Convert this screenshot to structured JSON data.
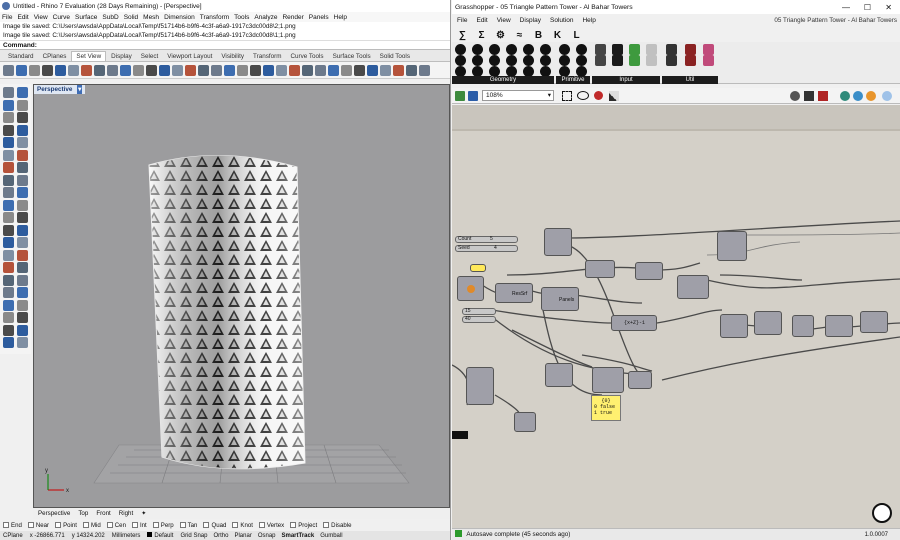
{
  "rhino": {
    "title": "Untitled - Rhino 7 Evaluation (28 Days Remaining) - [Perspective]",
    "menu": [
      "File",
      "Edit",
      "View",
      "Curve",
      "Surface",
      "SubD",
      "Solid",
      "Mesh",
      "Dimension",
      "Transform",
      "Tools",
      "Analyze",
      "Render",
      "Panels",
      "Help"
    ],
    "command_history": [
      "Image tile saved: C:\\Users\\awsda\\AppData\\Local\\Temp\\f51714b6-b9f6-4c3f-a6a9-1917c3dc00d8\\2;1.png",
      "Image tile saved: C:\\Users\\awsda\\AppData\\Local\\Temp\\f51714b6-b9f6-4c3f-a6a9-1917c3dc00d8\\1;1.png"
    ],
    "command_prompt": "Command:",
    "toolbar_tabs": [
      "Standard",
      "CPlanes",
      "Set View",
      "Display",
      "Select",
      "Viewport Layout",
      "Visibility",
      "Transform",
      "Curve Tools",
      "Surface Tools",
      "Solid Tools"
    ],
    "active_toolbar_tab": "Set View",
    "viewport_label": "Perspective",
    "viewport_tabs": [
      "Perspective",
      "Top",
      "Front",
      "Right"
    ],
    "osnaps": [
      "End",
      "Near",
      "Point",
      "Mid",
      "Cen",
      "Int",
      "Perp",
      "Tan",
      "Quad",
      "Knot",
      "Vertex",
      "Project",
      "Disable"
    ],
    "status": {
      "cplane": "CPlane",
      "x": "x -26866.771",
      "y": "y 14324.202",
      "units": "Millimeters",
      "layer": "Default",
      "items": [
        "Grid Snap",
        "Ortho",
        "Planar",
        "Osnap",
        "SmartTrack",
        "Gumball"
      ]
    },
    "viewport_bg": "#9c9c9e"
  },
  "grasshopper": {
    "title": "Grasshopper - 05 Triangle Pattern Tower - Al Bahar Towers",
    "document_name": "05 Triangle Pattern Tower - Al Bahar Towers",
    "menu": [
      "File",
      "Edit",
      "View",
      "Display",
      "Solution",
      "Help"
    ],
    "ribbon_tabs": [
      "∑",
      "Σ",
      "⚙",
      "≈",
      "B",
      "K",
      "L"
    ],
    "ribbon_groups": [
      "Geometry",
      "Primitive",
      "Input",
      "Util"
    ],
    "zoom": "108%",
    "sliders": [
      {
        "label": "Count",
        "value": "5"
      },
      {
        "label": "Seed",
        "value": "4"
      },
      {
        "label": "",
        "value": "15"
      },
      {
        "label": "",
        "value": "40"
      }
    ],
    "components": [
      "ResSrf",
      "Panels",
      "{x+Z}-1"
    ],
    "panel_lines": [
      "{0}",
      "0 false",
      "1 true"
    ],
    "status_text": "Autosave complete (45 seconds ago)",
    "version": "1.0.0007",
    "canvas_bg": "#d4d0c8"
  }
}
